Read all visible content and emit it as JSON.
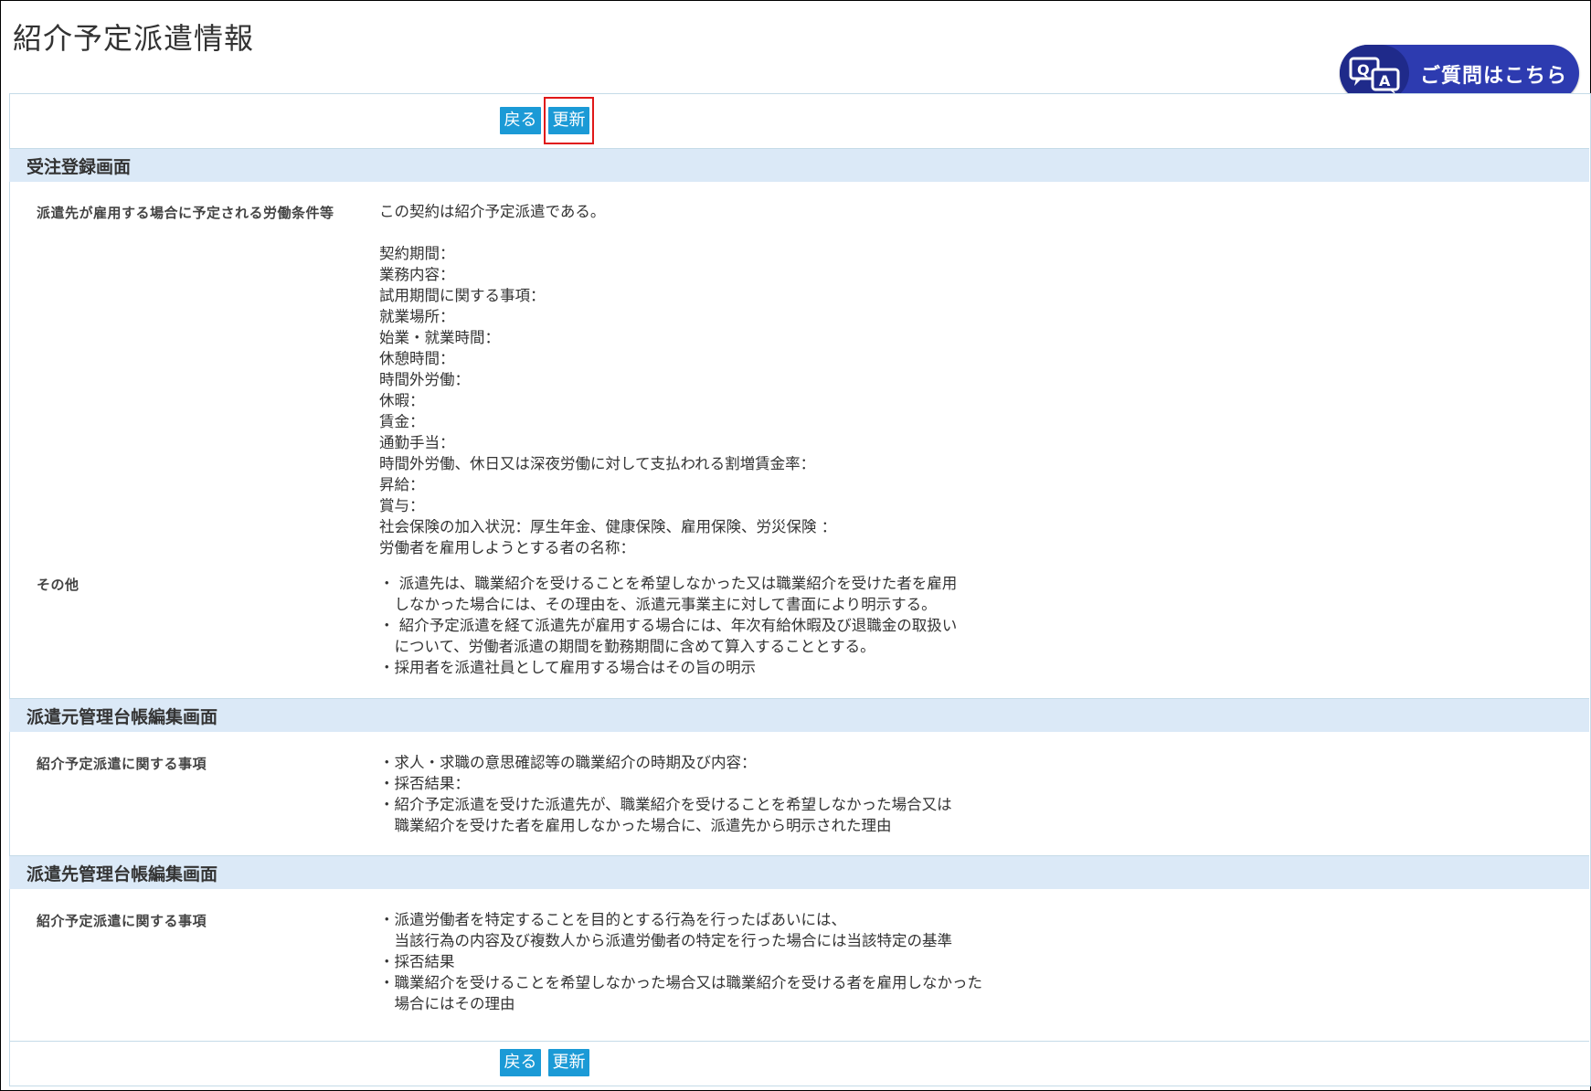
{
  "page_title": "紹介予定派遣情報",
  "help": {
    "label": "ご質問はこちら",
    "icon": "qa-chat-icon"
  },
  "buttons": {
    "back": "戻る",
    "update": "更新"
  },
  "sections": [
    {
      "title": "受注登録画面",
      "rows": [
        {
          "label": "派遣先が雇用する場合に予定される労働条件等",
          "lines": [
            "この契約は紹介予定派遣である。",
            "",
            "契約期間：",
            "業務内容：",
            "試用期間に関する事項：",
            "就業場所：",
            "始業・就業時間：",
            "休憩時間：",
            "時間外労働：",
            "休暇：",
            "賃金：",
            "通勤手当：",
            "時間外労働、休日又は深夜労働に対して支払われる割増賃金率：",
            "昇給：",
            "賞与：",
            "社会保険の加入状況：厚生年金、健康保険、雇用保険、労災保険 ：",
            "労働者を雇用しようとする者の名称："
          ]
        },
        {
          "label": "その他",
          "lines": [
            "・ 派遣先は、職業紹介を受けることを希望しなかった又は職業紹介を受けた者を雇用",
            "　しなかった場合には、その理由を、派遣元事業主に対して書面により明示する。",
            "・ 紹介予定派遣を経て派遣先が雇用する場合には、年次有給休暇及び退職金の取扱い",
            "　について、労働者派遣の期間を勤務期間に含めて算入することとする。",
            "・採用者を派遣社員として雇用する場合はその旨の明示"
          ]
        }
      ]
    },
    {
      "title": "派遣元管理台帳編集画面",
      "rows": [
        {
          "label": "紹介予定派遣に関する事項",
          "lines": [
            "・求人・求職の意思確認等の職業紹介の時期及び内容：",
            "・採否結果：",
            "・紹介予定派遣を受けた派遣先が、職業紹介を受けることを希望しなかった場合又は",
            "　職業紹介を受けた者を雇用しなかった場合に、派遣先から明示された理由"
          ]
        }
      ]
    },
    {
      "title": "派遣先管理台帳編集画面",
      "rows": [
        {
          "label": "紹介予定派遣に関する事項",
          "lines": [
            "・派遣労働者を特定することを目的とする行為を行ったばあいには、",
            "　当該行為の内容及び複数人から派遣労働者の特定を行った場合には当該特定の基準",
            "・採否結果",
            "・職業紹介を受けることを希望しなかった場合又は職業紹介を受ける者を雇用しなかった",
            "　場合にはその理由"
          ]
        }
      ]
    }
  ]
}
